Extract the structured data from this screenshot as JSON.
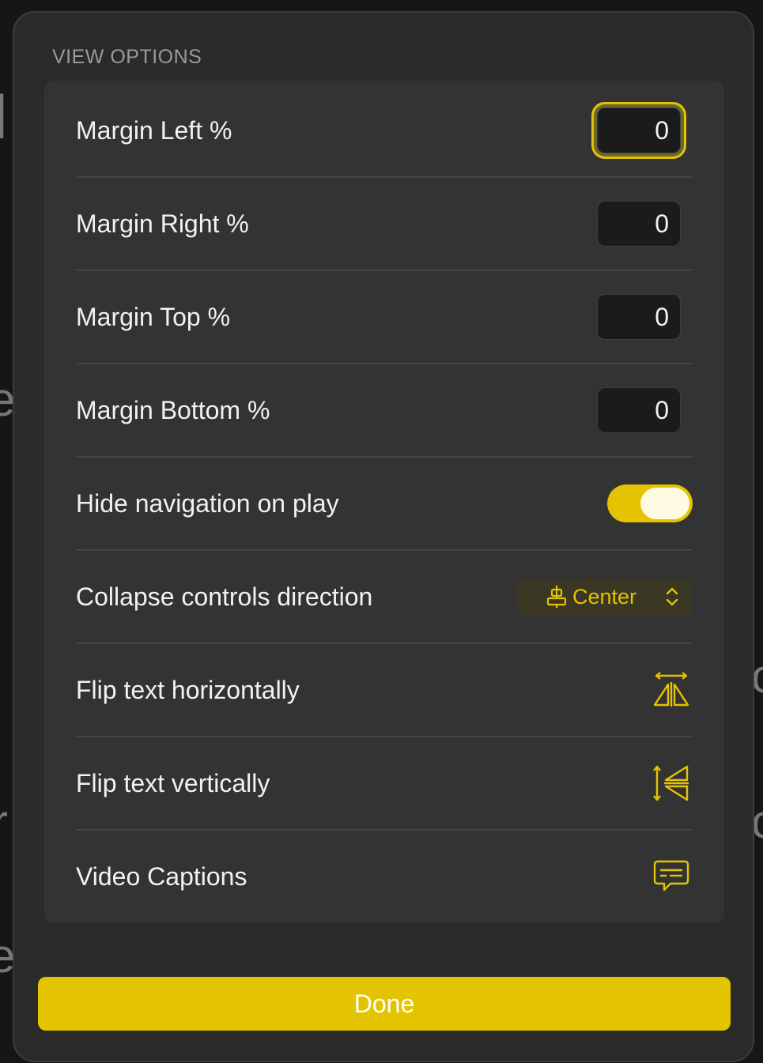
{
  "panel": {
    "section_title": "VIEW OPTIONS",
    "accent_color": "#e4c400"
  },
  "rows": {
    "margin_left": {
      "label": "Margin Left %",
      "value": "0"
    },
    "margin_right": {
      "label": "Margin Right %",
      "value": "0"
    },
    "margin_top": {
      "label": "Margin Top %",
      "value": "0"
    },
    "margin_bottom": {
      "label": "Margin Bottom %",
      "value": "0"
    },
    "hide_nav": {
      "label": "Hide navigation on play",
      "on": true
    },
    "collapse_dir": {
      "label": "Collapse controls direction",
      "selected": "Center",
      "icon": "align-center-icon"
    },
    "flip_h": {
      "label": "Flip text horizontally",
      "icon": "flip-horizontal-icon"
    },
    "flip_v": {
      "label": "Flip text vertically",
      "icon": "flip-vertical-icon"
    },
    "captions": {
      "label": "Video Captions",
      "icon": "captions-icon"
    }
  },
  "done_label": "Done"
}
